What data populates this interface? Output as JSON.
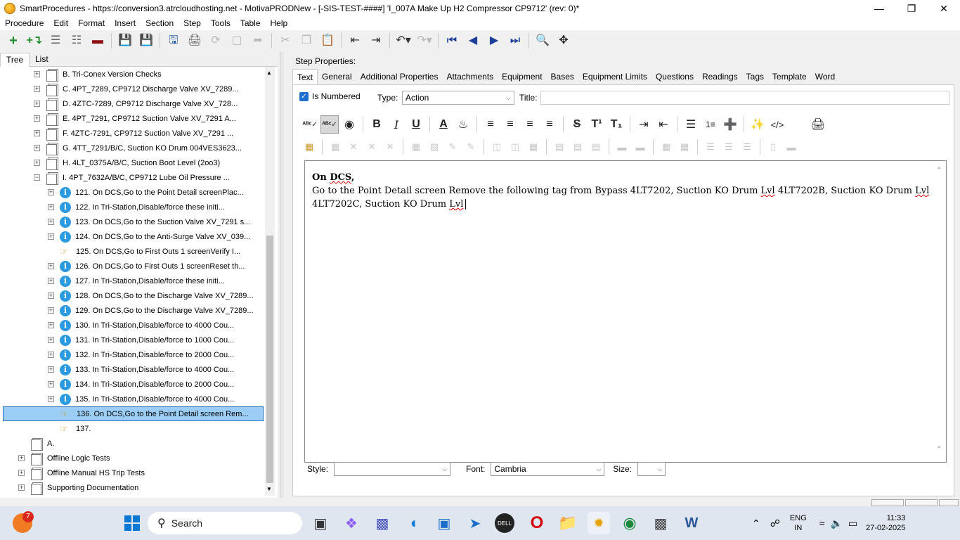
{
  "window": {
    "title": "SmartProcedures - https://conversion3.atrcloudhosting.net - MotivaPRODNew - [-SIS-TEST-####] 'I_007A Make Up H2 Compressor CP9712' (rev: 0)*",
    "minimize": "—",
    "maximize": "❐",
    "close": "✕"
  },
  "menu": [
    "Procedure",
    "Edit",
    "Format",
    "Insert",
    "Section",
    "Step",
    "Tools",
    "Table",
    "Help"
  ],
  "left_tabs": [
    "Tree",
    "List"
  ],
  "tree": [
    {
      "label": "B. Tri-Conex Version Checks",
      "kind": "doc",
      "level": 1,
      "exp": "+"
    },
    {
      "label": "C. 4PT_7289, CP9712 Discharge Valve XV_7289...",
      "kind": "doc",
      "level": 1,
      "exp": "+"
    },
    {
      "label": "D. 4ZTC-7289, CP9712 Discharge Valve XV_728...",
      "kind": "doc",
      "level": 1,
      "exp": "+"
    },
    {
      "label": "E. 4PT_7291, CP9712 Suction Valve XV_7291 A...",
      "kind": "doc",
      "level": 1,
      "exp": "+"
    },
    {
      "label": "F. 4ZTC-7291, CP9712 Suction Valve XV_7291 ...",
      "kind": "doc",
      "level": 1,
      "exp": "+"
    },
    {
      "label": "G. 4TT_7291/B/C, Suction KO Drum 004VES3623...",
      "kind": "doc",
      "level": 1,
      "exp": "+"
    },
    {
      "label": "H. 4LT_0375A/B/C, Suction Boot Level (2oo3)",
      "kind": "doc",
      "level": 1,
      "exp": "+"
    },
    {
      "label": "I. 4PT_7632A/B/C, CP9712 Lube Oil Pressure ...",
      "kind": "doc",
      "level": 1,
      "exp": "−"
    },
    {
      "label": "121. On DCS,Go to the Point Detail screenPlac...",
      "kind": "info",
      "level": 2,
      "exp": "+"
    },
    {
      "label": "122. In Tri-Station,Disable/force these initi...",
      "kind": "info",
      "level": 2,
      "exp": "+"
    },
    {
      "label": "123. On DCS,Go to the Suction Valve XV_7291 s...",
      "kind": "info",
      "level": 2,
      "exp": "+"
    },
    {
      "label": "124. On DCS,Go to the Anti-Surge Valve XV_039...",
      "kind": "info",
      "level": 2,
      "exp": "+"
    },
    {
      "label": "125. On DCS,Go to First Outs 1 screenVerify I...",
      "kind": "hand",
      "level": 2,
      "exp": ""
    },
    {
      "label": "126. On DCS,Go to First Outs 1 screenReset th...",
      "kind": "info",
      "level": 2,
      "exp": "+"
    },
    {
      "label": "127. In Tri-Station,Disable/force these initi...",
      "kind": "info",
      "level": 2,
      "exp": "+"
    },
    {
      "label": "128. On DCS,Go to the Discharge Valve XV_7289...",
      "kind": "info",
      "level": 2,
      "exp": "+"
    },
    {
      "label": "129. On DCS,Go to the Discharge Valve XV_7289...",
      "kind": "info",
      "level": 2,
      "exp": "+"
    },
    {
      "label": "130. In Tri-Station,Disable/force to 4000 Cou...",
      "kind": "info",
      "level": 2,
      "exp": "+"
    },
    {
      "label": "131. In Tri-Station,Disable/force to 1000 Cou...",
      "kind": "info",
      "level": 2,
      "exp": "+"
    },
    {
      "label": "132. In Tri-Station,Disable/force to 2000 Cou...",
      "kind": "info",
      "level": 2,
      "exp": "+"
    },
    {
      "label": "133. In Tri-Station,Disable/force to 4000 Cou...",
      "kind": "info",
      "level": 2,
      "exp": "+"
    },
    {
      "label": "134. In Tri-Station,Disable/force to 2000 Cou...",
      "kind": "info",
      "level": 2,
      "exp": "+"
    },
    {
      "label": "135. In Tri-Station,Disable/force to 4000 Cou...",
      "kind": "info",
      "level": 2,
      "exp": "+"
    },
    {
      "label": "136. On DCS,Go to the Point Detail screen Rem...",
      "kind": "hand",
      "level": 2,
      "exp": "",
      "selected": true
    },
    {
      "label": "137.",
      "kind": "hand",
      "level": 2,
      "exp": ""
    },
    {
      "label": "A.",
      "kind": "doc",
      "level": 0,
      "exp": ""
    },
    {
      "label": "Offline Logic Tests",
      "kind": "doc",
      "level": 0,
      "exp": "+"
    },
    {
      "label": "Offline Manual HS Trip Tests",
      "kind": "doc",
      "level": 0,
      "exp": "+"
    },
    {
      "label": "Supporting Documentation",
      "kind": "doc",
      "level": 0,
      "exp": "+"
    }
  ],
  "step_properties": {
    "header": "Step Properties:",
    "tabs": [
      "Text",
      "General",
      "Additional Properties",
      "Attachments",
      "Equipment",
      "Bases",
      "Equipment Limits",
      "Questions",
      "Readings",
      "Tags",
      "Template",
      "Word"
    ],
    "is_numbered_label": "Is Numbered",
    "is_numbered_checked": "✓",
    "type_label": "Type:",
    "type_value": "Action",
    "title_label": "Title:",
    "title_value": ""
  },
  "editor": {
    "line1": "On DCS,",
    "line2": "Go to the Point Detail screen Remove the following tag from Bypass 4LT7202, Suction KO Drum Lvl 4LT7202B, Suction KO Drum Lvl 4LT7202C, Suction KO Drum Lvl"
  },
  "format_bar": {
    "style_label": "Style:",
    "style_value": "",
    "font_label": "Font:",
    "font_value": "Cambria",
    "size_label": "Size:",
    "size_value": ""
  },
  "taskbar": {
    "search_placeholder": "Search",
    "notif_badge": "7",
    "lang_line1": "ENG",
    "lang_line2": "IN",
    "time": "11:33",
    "date": "27-02-2025"
  }
}
